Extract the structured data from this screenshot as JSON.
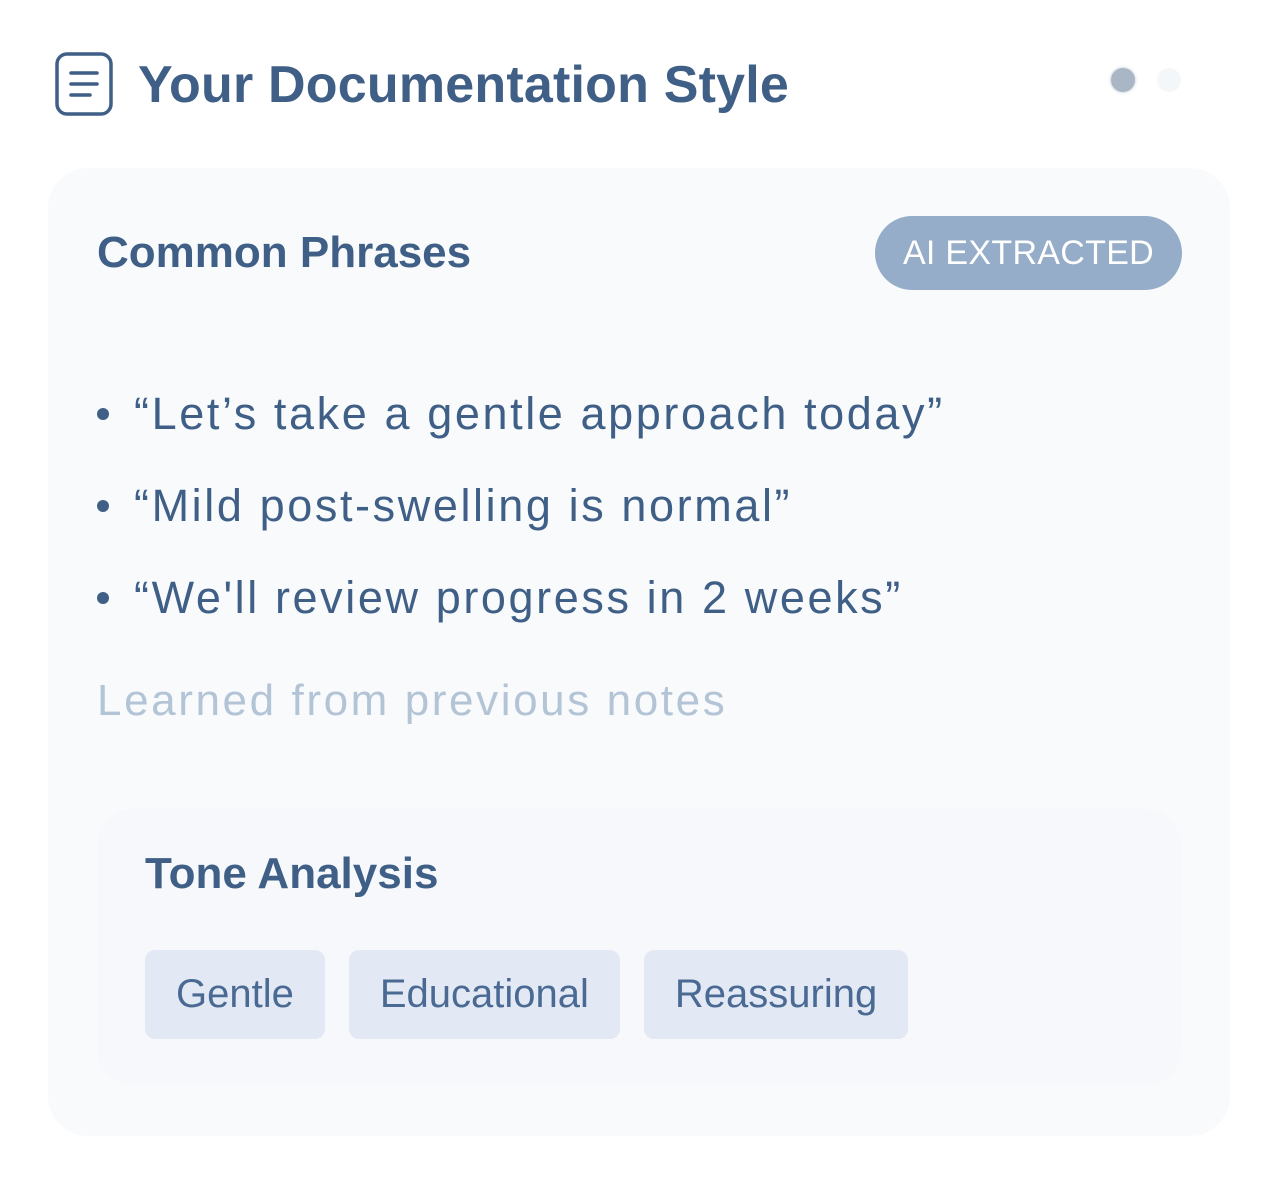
{
  "header": {
    "title": "Your Documentation Style",
    "icon": "document-lines-icon"
  },
  "phrases_section": {
    "heading": "Common Phrases",
    "badge": "AI EXTRACTED",
    "items": [
      "“Let’s take a gentle approach today”",
      "“Mild post-swelling is normal”",
      "“We'll review progress in 2 weeks”"
    ],
    "footnote": "Learned from previous notes"
  },
  "tone_section": {
    "heading": "Tone Analysis",
    "tags": [
      "Gentle",
      "Educational",
      "Reassuring"
    ]
  },
  "colors": {
    "text_primary": "#3f5f86",
    "badge_bg": "#95adc9",
    "muted_text": "#b3c4d6",
    "tag_bg": "#e3e9f4",
    "card_bg": "#f8fafc"
  }
}
